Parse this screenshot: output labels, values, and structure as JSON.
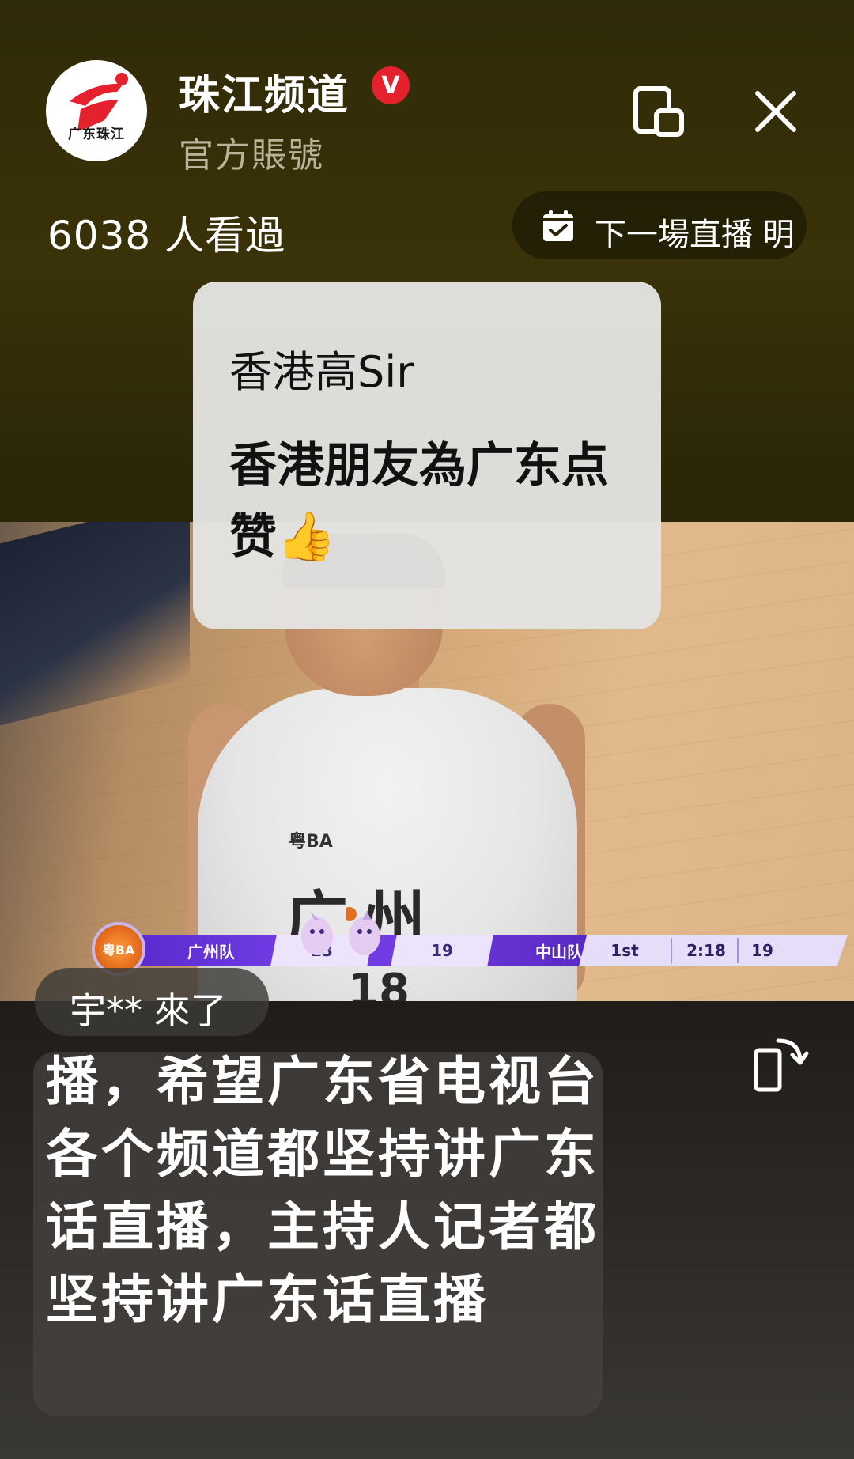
{
  "header": {
    "avatar_logo_text": "广东珠江",
    "channel_name": "珠江频道",
    "verified_badge": "V",
    "account_type": "官方賬號",
    "icons": {
      "pip": "picture-in-picture-icon",
      "close": "close-icon"
    }
  },
  "stats": {
    "viewers": "6038 人看過"
  },
  "next_live": {
    "icon": "calendar-check-icon",
    "label": "下一場直播 明"
  },
  "bubble_comment": {
    "user": "香港高Sir",
    "message": "香港朋友為广东点赞👍"
  },
  "video": {
    "jersey_brand": "粤BA",
    "jersey_text": "广州",
    "jersey_number": "18",
    "scoreboard": {
      "league_logo": "粤BA",
      "home_team": "广州队",
      "home_score": "23",
      "away_score": "19",
      "away_team": "中山队",
      "period": "1st",
      "clock": "2:18",
      "shot_clock": "19"
    }
  },
  "join_notice": "宇** 來了",
  "main_comment": "播，希望广东省电视台各个频道都坚持讲广东话直播，主持人记者都坚持讲广东话直播",
  "icons": {
    "rotate": "rotate-screen-icon"
  },
  "colors": {
    "accent_red": "#e4212c",
    "scoreboard_purple": "#6b35d8"
  }
}
